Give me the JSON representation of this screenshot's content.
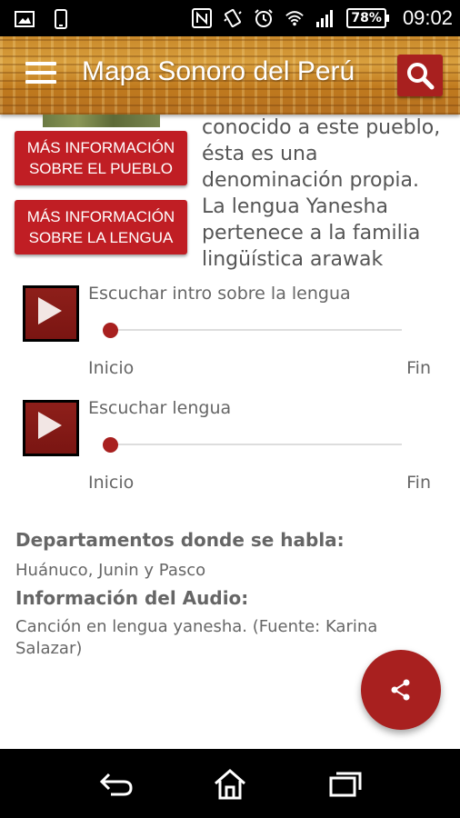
{
  "status_bar": {
    "battery": "78%",
    "time": "09:02",
    "icons": [
      "image-icon",
      "phone-icon",
      "nfc-icon",
      "vibrate-icon",
      "alarm-icon",
      "wifi-icon",
      "signal-icon"
    ]
  },
  "app_bar": {
    "title": "Mapa Sonoro del Perú",
    "menu_icon": "menu-icon",
    "search_icon": "search-icon"
  },
  "buttons": {
    "pueblo": "MÁS INFORMACIÓN\nSOBRE EL PUEBLO",
    "lengua": "MÁS INFORMACIÓN\nSOBRE LA LENGUA"
  },
  "description": {
    "lines": [
      "conocido a este pueblo,",
      "ésta es una",
      "denominación propia.",
      "La lengua Yanesha",
      "pertenece a la familia",
      "lingüística arawak"
    ]
  },
  "players": [
    {
      "title": "Escuchar intro sobre la lengua",
      "start": "Inicio",
      "end": "Fin",
      "progress": 0
    },
    {
      "title": "Escuchar lengua",
      "start": "Inicio",
      "end": "Fin",
      "progress": 0
    }
  ],
  "details": {
    "departments_label": "Departamentos donde se habla:",
    "departments_value": "Huánuco, Junin y Pasco",
    "audio_label": "Información del Audio:",
    "audio_value": "Canción en lengua yanesha. (Fuente: Karina Salazar)"
  },
  "fab": {
    "icon": "share-icon"
  },
  "nav_bar": {
    "icons": [
      "back-icon",
      "home-icon",
      "recent-apps-icon"
    ]
  },
  "colors": {
    "accent": "#a8201f",
    "button_red": "#c01e24",
    "appbar_gold": "#c9892a",
    "text_gray": "#666666"
  }
}
